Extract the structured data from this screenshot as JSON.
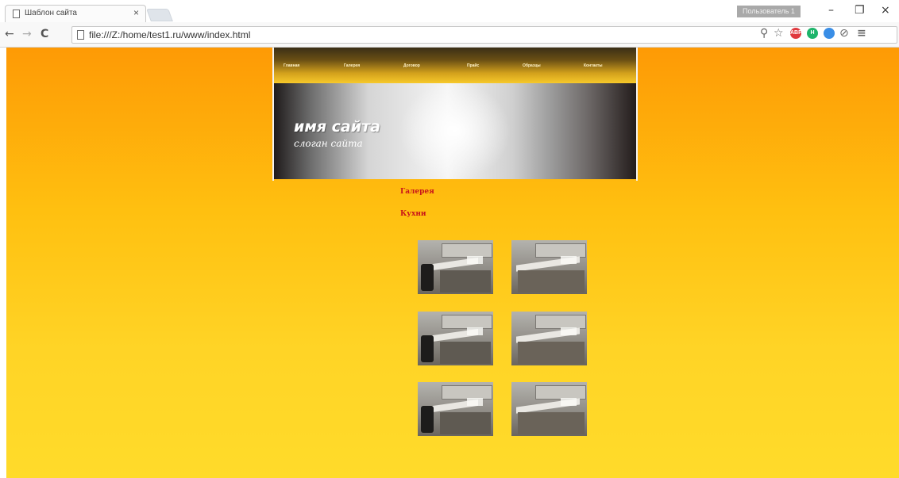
{
  "browser": {
    "tab_title": "Шаблон сайта",
    "tab_close": "×",
    "profile_label": "Пользователь 1",
    "address": "file:///Z:/home/test1.ru/www/index.html",
    "window_controls": {
      "minimize": "–",
      "restore": "❐",
      "close": "×"
    },
    "nav": {
      "back": "←",
      "forward": "→",
      "reload": "C"
    },
    "extensions": [
      {
        "icon": "adblock-icon",
        "label": "ABP",
        "color": "#e0393e"
      },
      {
        "icon": "extension-green-icon",
        "label": "H",
        "color": "#1db46a"
      },
      {
        "icon": "extension-blue-icon",
        "label": "",
        "color": "#3a8ee6"
      }
    ]
  },
  "site": {
    "nav": [
      "Главная",
      "Галерея",
      "Договор",
      "Прайс",
      "Образцы",
      "Контакты"
    ],
    "name": "имя сайта",
    "slogan": "слоган сайта",
    "colors": {
      "background_top": "#fe9a05",
      "background_bottom": "#ffdb2a",
      "link": "#c8141a"
    }
  },
  "content": {
    "breadcrumb": "Галерея",
    "section": "Кухни",
    "gallery": [
      {
        "alt": "kitchen-photo"
      },
      {
        "alt": "kitchen-photo"
      },
      {
        "alt": "kitchen-photo"
      },
      {
        "alt": "kitchen-photo"
      },
      {
        "alt": "kitchen-photo"
      },
      {
        "alt": "kitchen-photo"
      }
    ]
  }
}
